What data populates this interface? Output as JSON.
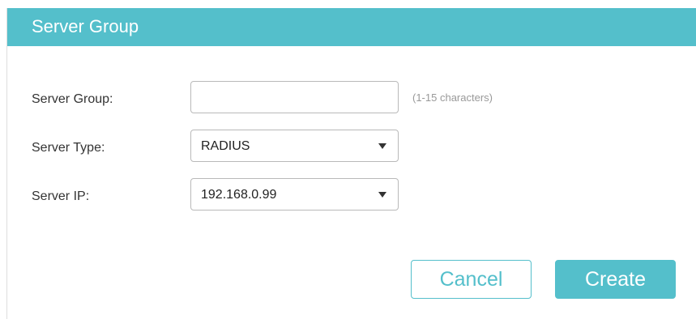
{
  "dialog": {
    "title": "Server Group"
  },
  "form": {
    "server_group": {
      "label": "Server Group:",
      "value": "",
      "hint": "(1-15 characters)"
    },
    "server_type": {
      "label": "Server Type:",
      "selected": "RADIUS"
    },
    "server_ip": {
      "label": "Server IP:",
      "selected": "192.168.0.99"
    }
  },
  "buttons": {
    "cancel_label": "Cancel",
    "create_label": "Create"
  },
  "colors": {
    "accent": "#54bfcb",
    "hint_text": "#999999",
    "label_text": "#333333",
    "input_border": "#b9b9b9"
  },
  "icons": {
    "dropdown": "caret-down-icon"
  }
}
